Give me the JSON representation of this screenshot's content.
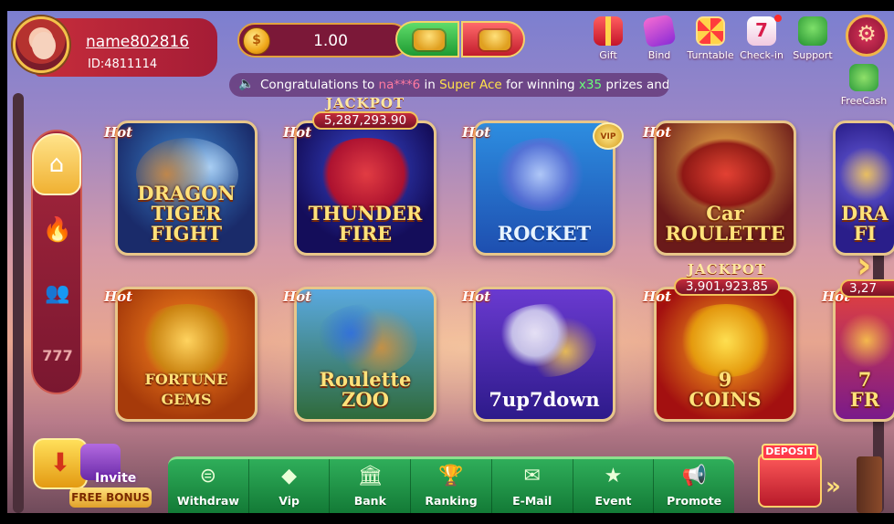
{
  "profile": {
    "username": "name802816",
    "user_id": "ID:4811114"
  },
  "balance": {
    "coin_symbol": "$",
    "value": "1.00"
  },
  "top_actions": [
    {
      "label": "Gift",
      "icon": "gift-icon"
    },
    {
      "label": "Bind",
      "icon": "phone-bind-icon"
    },
    {
      "label": "Turntable",
      "icon": "turntable-icon"
    },
    {
      "label": "Check-in",
      "icon": "calendar-check-icon"
    },
    {
      "label": "Support",
      "icon": "support-icon"
    }
  ],
  "freecash": {
    "label": "FreeCash"
  },
  "marquee": {
    "prefix": "Congratulations to ",
    "player": "na***6",
    "middle": " in ",
    "game": "Super Ace",
    "winning": " for winning ",
    "multiplier": "x35",
    "suffix": " prizes and"
  },
  "side_menu": [
    {
      "icon": "home-icon",
      "glyph": "⌂"
    },
    {
      "icon": "fire-icon",
      "glyph": "🔥"
    },
    {
      "icon": "people-icon",
      "glyph": "👥"
    },
    {
      "icon": "slot-777-icon",
      "glyph": "777"
    }
  ],
  "hot_label": "Hot",
  "vip_label": "VIP",
  "jackpot_label": "JACKPOT",
  "games": [
    {
      "title": "DRAGON\nTIGER FIGHT",
      "jackpot": null
    },
    {
      "title": "THUNDER\nFIRE",
      "jackpot": "5,287,293.90"
    },
    {
      "title": "ROCKET",
      "jackpot": null
    },
    {
      "title": "Car\nROULETTE",
      "jackpot": null
    },
    {
      "title": "DRA\nFI",
      "jackpot": null
    },
    {
      "title": "FORTUNE GEMS",
      "jackpot": null
    },
    {
      "title": "Roulette\nZOO",
      "jackpot": null
    },
    {
      "title": "7up7down",
      "jackpot": null
    },
    {
      "title": "9\nCOINS",
      "jackpot": "3,901,923.85"
    },
    {
      "title": "7\nFR",
      "jackpot": "3,27"
    }
  ],
  "invite": {
    "label": "Invite",
    "bonus": "FREE BONUS"
  },
  "bottom_nav": [
    {
      "label": "Withdraw",
      "icon": "withdraw-icon",
      "glyph": "⊜"
    },
    {
      "label": "Vip",
      "icon": "vip-diamond-icon",
      "glyph": "◆"
    },
    {
      "label": "Bank",
      "icon": "bank-icon",
      "glyph": "🏛"
    },
    {
      "label": "Ranking",
      "icon": "trophy-icon",
      "glyph": "🏆"
    },
    {
      "label": "E-Mail",
      "icon": "mail-icon",
      "glyph": "✉"
    },
    {
      "label": "Event",
      "icon": "event-icon",
      "glyph": "★"
    },
    {
      "label": "Promote",
      "icon": "promote-icon",
      "glyph": "📢"
    }
  ],
  "deposit": {
    "label": "DEPOSIT"
  },
  "colors": {
    "accent_gold": "#f3c24a",
    "nav_green": "#1e8f42",
    "profile_red": "#c62d3b"
  }
}
